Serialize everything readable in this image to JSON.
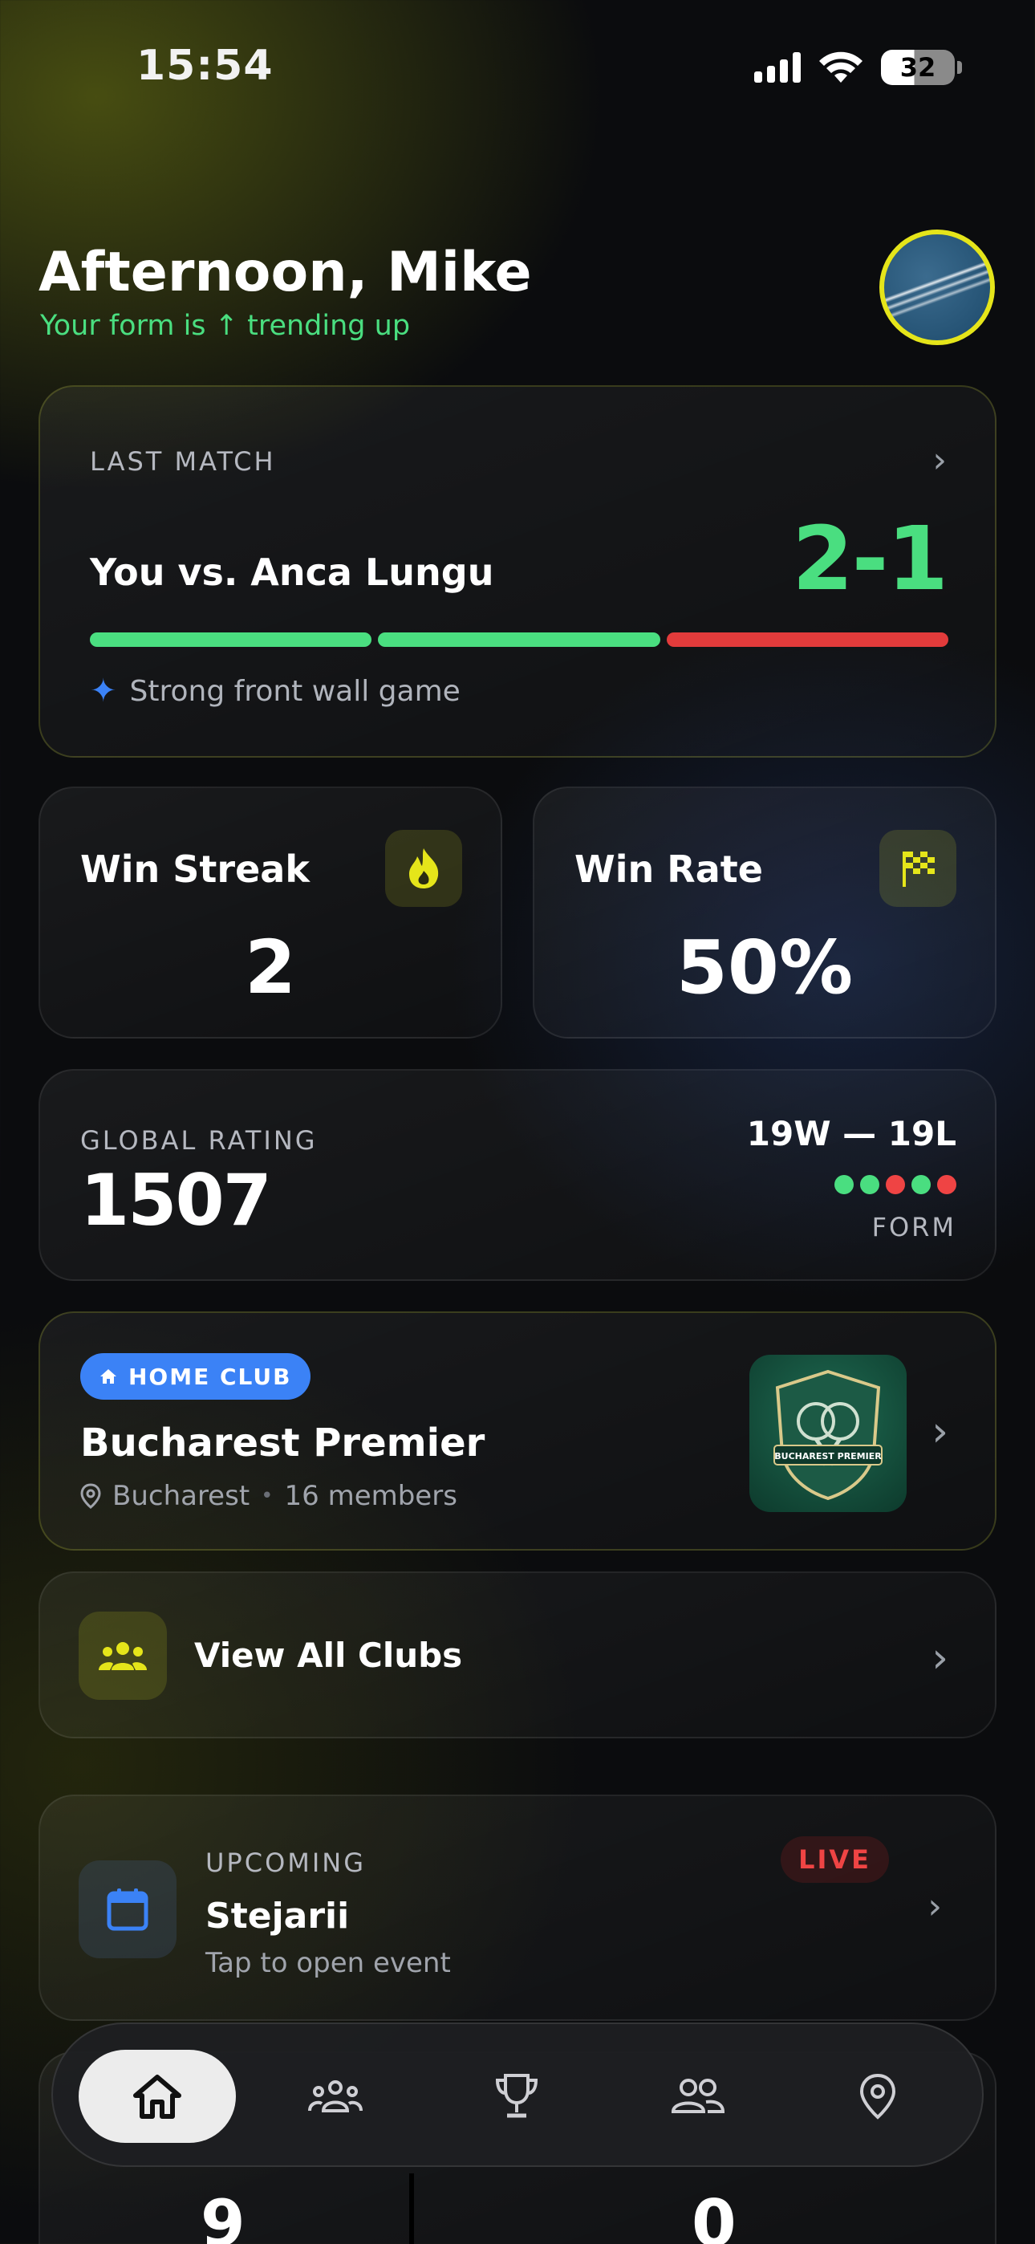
{
  "status_bar": {
    "time": "15:54",
    "battery": "32"
  },
  "header": {
    "greeting": "Afternoon, Mike",
    "trend": "Your form is ↑ trending up"
  },
  "last_match": {
    "label": "LAST MATCH",
    "opponent_line": "You vs. Anca Lungu",
    "score": "2-1",
    "sets": [
      "win",
      "win",
      "loss"
    ],
    "note": "Strong front wall game",
    "colors": {
      "win": "#4ade80",
      "loss": "#e23b3b"
    }
  },
  "stats": {
    "win_streak": {
      "label": "Win Streak",
      "value": "2",
      "icon": "flame-icon"
    },
    "win_rate": {
      "label": "Win Rate",
      "value": "50%",
      "icon": "checkered-flag-icon"
    }
  },
  "rating": {
    "label": "GLOBAL RATING",
    "value": "1507",
    "record": "19W — 19L",
    "form": [
      "W",
      "W",
      "L",
      "W",
      "L"
    ],
    "form_label": "FORM"
  },
  "home_club": {
    "badge": "HOME CLUB",
    "name": "Bucharest Premier",
    "city": "Bucharest",
    "separator": "•",
    "members": "16 members",
    "logo_text": "BUCHAREST PREMIER"
  },
  "clubs_link": {
    "label": "View All Clubs"
  },
  "upcoming": {
    "label": "UPCOMING",
    "status": "LIVE",
    "title": "Stejarii",
    "subtitle": "Tap to open event"
  },
  "bottom_stats": {
    "left_value": "9",
    "right_value": "0"
  },
  "nav": {
    "items": [
      "home-icon",
      "people-icon",
      "trophy-icon",
      "friends-icon",
      "location-icon"
    ],
    "active": "home-icon"
  },
  "accent": {
    "lime": "#e5e51a",
    "green": "#4ade80",
    "red": "#ef4444",
    "blue": "#3b82f6"
  }
}
